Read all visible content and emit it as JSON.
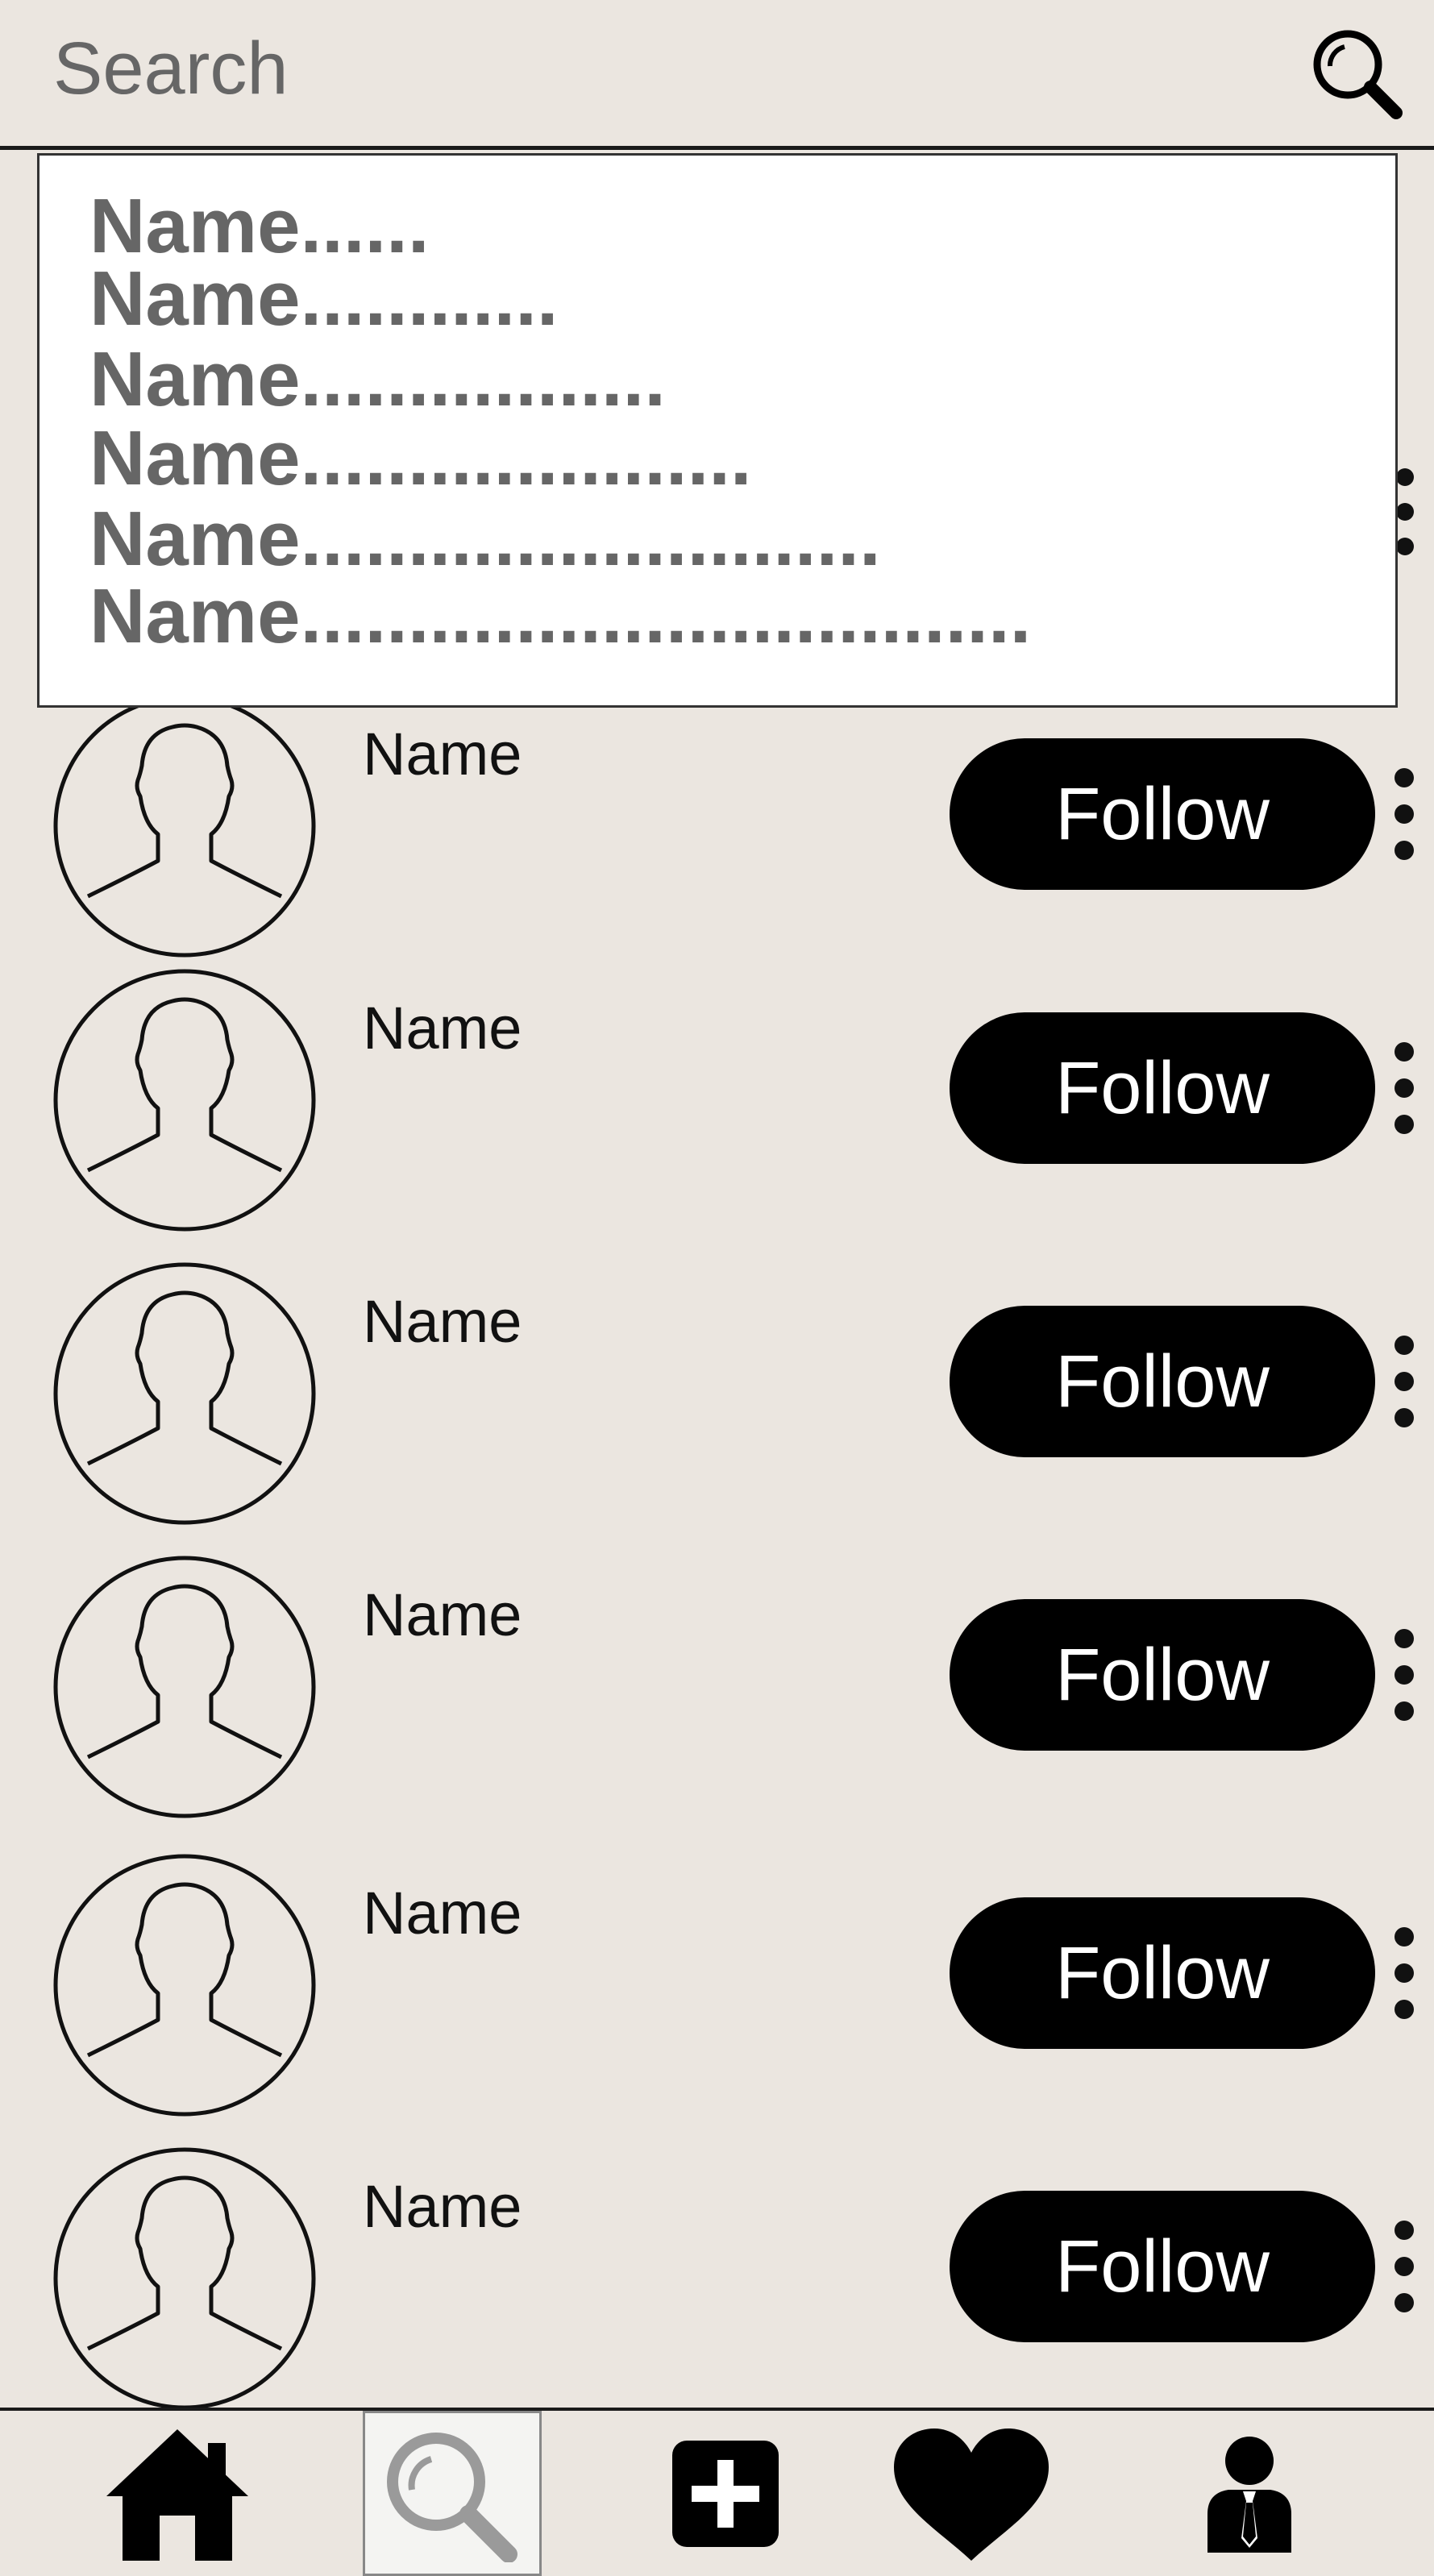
{
  "search": {
    "placeholder": "Search",
    "icon": "search-icon"
  },
  "suggestions": [
    "Name......",
    "Name............",
    "Name.................",
    "Name.....................",
    "Name...........................",
    "Name.................................."
  ],
  "users": [
    {
      "name": "Name",
      "button": "Follow"
    },
    {
      "name": "Name",
      "button": "Follow"
    },
    {
      "name": "Name",
      "button": "Follow"
    },
    {
      "name": "Name",
      "button": "Follow"
    },
    {
      "name": "Name",
      "button": "Follow"
    },
    {
      "name": "Name",
      "button": "Follow"
    }
  ],
  "nav": {
    "items": [
      "home-icon",
      "search-icon",
      "add-icon",
      "heart-icon",
      "profile-icon"
    ],
    "active": "search-icon"
  },
  "colors": {
    "background": "#ebe6e0",
    "button": "#000000",
    "button_text": "#ffffff",
    "muted_text": "#666666"
  }
}
